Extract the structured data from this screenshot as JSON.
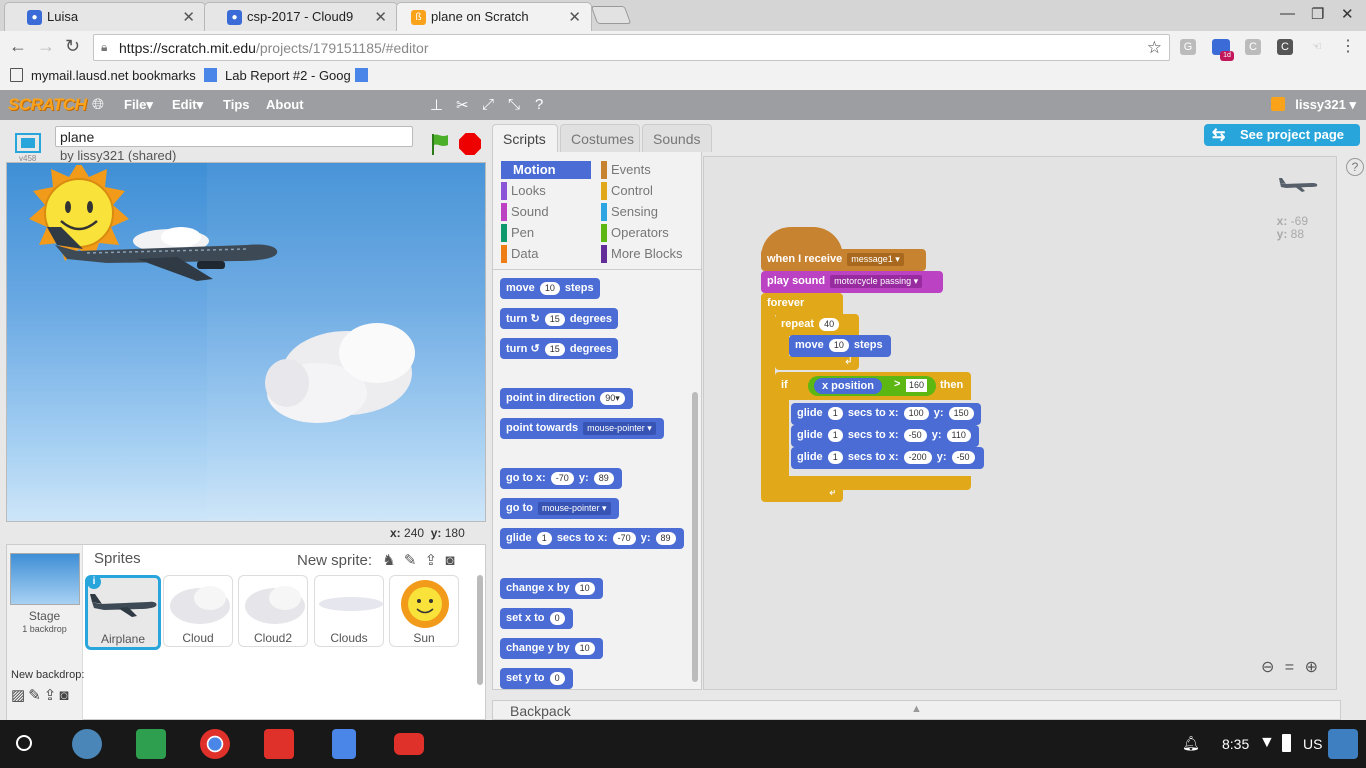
{
  "tabs": [
    {
      "title": "Luisa",
      "fav_color": "#3b6bd6"
    },
    {
      "title": "csp-2017 - Cloud9",
      "fav_color": "#3b6bd6"
    },
    {
      "title": "plane on Scratch",
      "fav_color": "#f9a21a"
    }
  ],
  "omnibox": {
    "origin": "https://scratch.mit.edu",
    "path": "/projects/179151185/#editor"
  },
  "extensions": [
    "G",
    "1d",
    "C",
    "C"
  ],
  "bookmarks": [
    "mymail.lausd.net bookmarks",
    "Lab Report #2 - Goog"
  ],
  "scratch_menu": {
    "logo": "SCRATCH",
    "items": [
      "File",
      "Edit",
      "Tips",
      "About"
    ],
    "user": "lissy321"
  },
  "stage": {
    "project_name": "plane",
    "owner": "by lissy321 (shared)",
    "version": "v458",
    "coords_x_label": "x:",
    "coords_x": "240",
    "coords_y_label": "y:",
    "coords_y": "180"
  },
  "sprites": {
    "title": "Sprites",
    "new_sprite_label": "New sprite:",
    "stage_label": "Stage",
    "stage_sub": "1 backdrop",
    "new_backdrop_label": "New backdrop:",
    "list": [
      "Airplane",
      "Cloud",
      "Cloud2",
      "Clouds",
      "Sun"
    ]
  },
  "editor_tabs": [
    "Scripts",
    "Costumes",
    "Sounds"
  ],
  "see_project_label": "See project page",
  "categories": [
    {
      "name": "Motion",
      "color": "#4a6cd4"
    },
    {
      "name": "Events",
      "color": "#c88330"
    },
    {
      "name": "Looks",
      "color": "#8a55d7"
    },
    {
      "name": "Control",
      "color": "#e1a91a"
    },
    {
      "name": "Sound",
      "color": "#bb42c3"
    },
    {
      "name": "Sensing",
      "color": "#2ca5e2"
    },
    {
      "name": "Pen",
      "color": "#0e9a6c"
    },
    {
      "name": "Operators",
      "color": "#5cb712"
    },
    {
      "name": "Data",
      "color": "#ee7d16"
    },
    {
      "name": "More Blocks",
      "color": "#632d99"
    }
  ],
  "palette": {
    "move": [
      "move",
      "10",
      "steps"
    ],
    "turn_cw": [
      "turn",
      "15",
      "degrees"
    ],
    "turn_ccw": [
      "turn",
      "15",
      "degrees"
    ],
    "point_dir": [
      "point in direction",
      "90▾"
    ],
    "point_towards": [
      "point towards",
      "mouse-pointer ▾"
    ],
    "goto_xy": [
      "go to x:",
      "-70",
      "y:",
      "89"
    ],
    "goto": [
      "go to",
      "mouse-pointer ▾"
    ],
    "glide": [
      "glide",
      "1",
      "secs to x:",
      "-70",
      "y:",
      "89"
    ],
    "change_x": [
      "change x by",
      "10"
    ],
    "set_x": [
      "set x to",
      "0"
    ],
    "change_y": [
      "change y by",
      "10"
    ],
    "set_y": [
      "set y to",
      "0"
    ]
  },
  "script": {
    "when_receive": [
      "when I receive",
      "message1 ▾"
    ],
    "play_sound": [
      "play sound",
      "motorcycle passing ▾"
    ],
    "forever": "forever",
    "repeat": [
      "repeat",
      "40"
    ],
    "move": [
      "move",
      "10",
      "steps"
    ],
    "if": [
      "if",
      "then"
    ],
    "cond": [
      "x position",
      ">",
      "160"
    ],
    "glides": [
      [
        "glide",
        "1",
        "secs to x:",
        "100",
        "y:",
        "150"
      ],
      [
        "glide",
        "1",
        "secs to x:",
        "-50",
        "y:",
        "110"
      ],
      [
        "glide",
        "1",
        "secs to x:",
        "-200",
        "y:",
        "-50"
      ]
    ]
  },
  "sprite_pos": {
    "x_label": "x:",
    "x": "-69",
    "y_label": "y:",
    "y": "88"
  },
  "backpack_label": "Backpack",
  "taskbar": {
    "time": "8:35",
    "lang": "US"
  }
}
